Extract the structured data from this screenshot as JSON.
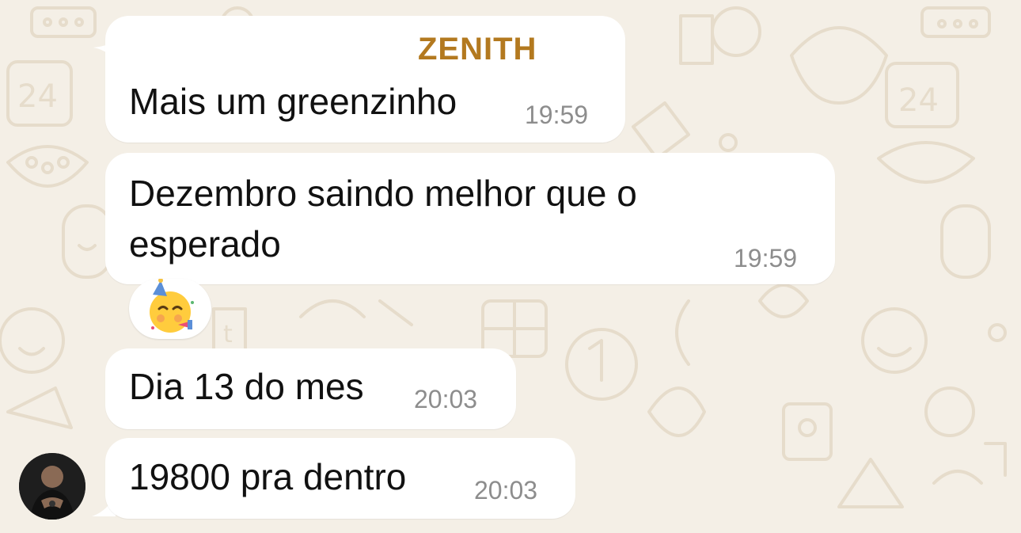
{
  "chat": {
    "sender_name_partial": "ZENITH",
    "sender_color": "#b3791f",
    "messages": [
      {
        "text": "Mais um greenzinho",
        "time": "19:59"
      },
      {
        "text_line1": "Dezembro saindo melhor que o",
        "text_line2": "esperado",
        "time": "19:59"
      },
      {
        "text": "Dia 13 do mes",
        "time": "20:03"
      },
      {
        "text": "19800 pra dentro",
        "time": "20:03"
      }
    ],
    "reaction": {
      "emoji": "partying-face-emoji"
    },
    "avatar": {
      "description_icon": "user-avatar"
    }
  },
  "colors": {
    "wallpaper": "#f4efe6",
    "doodle": "#e6dccb",
    "bubble": "#ffffff",
    "text": "#111111",
    "time": "#8d8d8d"
  }
}
